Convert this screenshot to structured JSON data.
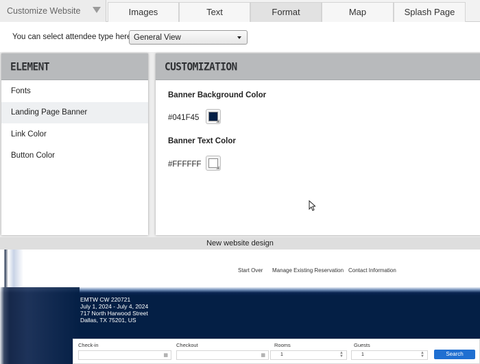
{
  "header": {
    "brand_label": "Customize Website",
    "tabs": [
      {
        "label": "Images",
        "active": false
      },
      {
        "label": "Text",
        "active": false
      },
      {
        "label": "Format",
        "active": true
      },
      {
        "label": "Map",
        "active": false
      },
      {
        "label": "Splash Page",
        "active": false
      }
    ]
  },
  "attendee": {
    "label": "You can select attendee type here:",
    "selected": "General View"
  },
  "element_panel": {
    "title": "ELEMENT",
    "items": [
      {
        "label": "Fonts",
        "selected": false
      },
      {
        "label": "Landing Page Banner",
        "selected": true
      },
      {
        "label": "Link Color",
        "selected": false
      },
      {
        "label": "Button Color",
        "selected": false
      }
    ]
  },
  "customization": {
    "title": "CUSTOMIZATION",
    "fields": [
      {
        "label": "Banner Background Color",
        "value": "#041F45",
        "swatch": "#041F45"
      },
      {
        "label": "Banner Text Color",
        "value": "#FFFFFF",
        "swatch": "#FFFFFF"
      }
    ]
  },
  "preview": {
    "caption": "New website design",
    "nav": [
      "Start Over",
      "Manage Existing Reservation",
      "Contact Information"
    ],
    "banner_lines": [
      "EMTW CW 220721",
      "July 1, 2024 - July 4, 2024",
      "717 North Harwood Street",
      "Dallas, TX 75201, US"
    ],
    "booking": {
      "checkin_label": "Check-in",
      "checkout_label": "Checkout",
      "rooms_label": "Rooms",
      "rooms_value": "1",
      "guests_label": "Guests",
      "guests_value": "1",
      "search_label": "Search"
    }
  },
  "colors": {
    "banner_background": "#041F45",
    "search_button": "#1F6FD1"
  }
}
